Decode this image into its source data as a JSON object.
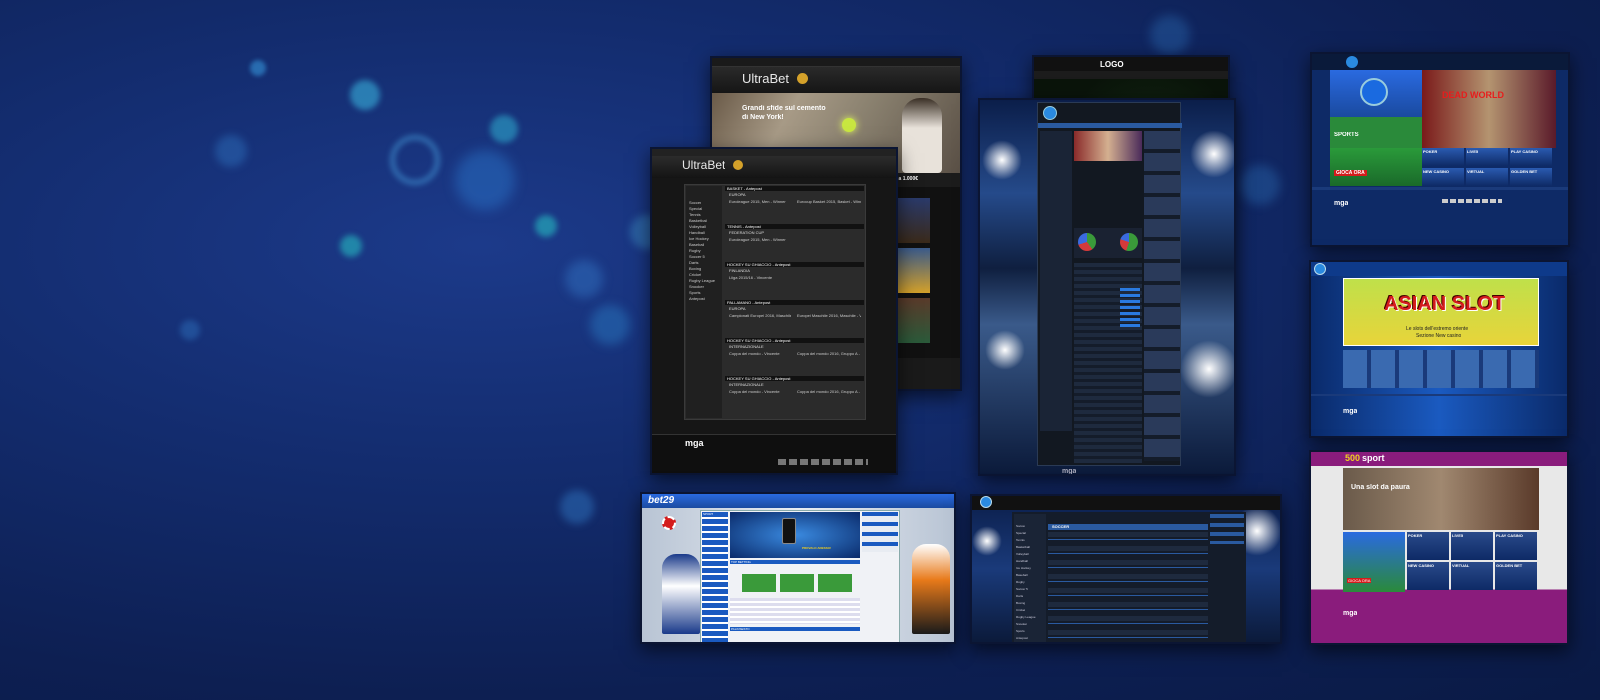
{
  "colors": {
    "background": "#0d1f52",
    "ultrabet_gold": "#d4a12a",
    "blue_accent": "#1e7ee0",
    "purple_accent": "#8a1c7c"
  },
  "ultrabet_back": {
    "brand": "UltraBet",
    "headline_line1": "Grandi sfide sul cemento",
    "headline_line2": "di New York!",
    "bonus": "fino a 1.000€"
  },
  "ultrabet_front": {
    "brand": "UltraBet",
    "sports": [
      "Soccer",
      "Special",
      "Tennis",
      "Basketball",
      "Volleyball",
      "Handball",
      "Ice Hockey",
      "Baseball",
      "Rugby",
      "Soccer 5",
      "Darts",
      "Boxing",
      "Cricket",
      "Rugby League",
      "Snooker",
      "Sports",
      "Antepost"
    ],
    "events": [
      {
        "title": "BASKET - Antepost",
        "group": "EUROPA",
        "left": "Euroleague 2015, Men - Winner",
        "right": "Eurocup Basket 2015, Basket - Winner"
      },
      {
        "title": "TENNIS - Antepost",
        "group": "FEDERATION CUP",
        "left": "Euroleague 2015, Men - Winner",
        "right": ""
      },
      {
        "title": "HOCKEY SU GHIACCIO - Antepost",
        "group": "FINLANDIA",
        "left": "Liiga 2015/16 - Vincente",
        "right": ""
      },
      {
        "title": "PALLAMANO - Antepost",
        "group": "EUROPA",
        "left": "Campionati Europei 2016, Maschile - Vincente",
        "right": "Europei Maschile 2016, Maschile - Vincente"
      },
      {
        "title": "HOCKEY SU GHIACCIO - Antepost",
        "group": "INTERNAZIONALE",
        "left": "Coppa del mondo - Vincente",
        "right": "Coppa del mondo 2016, Gruppo A - Vincente"
      },
      {
        "title": "HOCKEY SU GHIACCIO - Antepost",
        "group": "INTERNAZIONALE",
        "left": "Coppa del mondo - Vincente",
        "right": "Coppa del mondo 2016, Gruppo A - Vincente"
      }
    ],
    "footer_logo": "mga"
  },
  "dark_green_site": {
    "logo": "LOGO"
  },
  "stadium_site": {
    "footer_logo": "mga"
  },
  "blue_site_top": {
    "sports_label": "SPORTS",
    "cta": "GIOCA ORA",
    "dead_world": "DEAD WORLD",
    "tiles": [
      "POKER",
      "LIVE5",
      "PLAY CASINO",
      "NEW CASINO",
      "VIRTUAL",
      "GOLDEN BET"
    ],
    "footer_logo": "mga"
  },
  "asian_slot_site": {
    "title": "ASIAN SLOT",
    "subtitle_line1": "Le slots dell'estremo oriente",
    "subtitle_line2": "Sezione New casino",
    "footer_logo": "mga"
  },
  "sport500_site": {
    "brand_number": "500",
    "brand_word": "sport",
    "headline": "Una slot da paura",
    "cta": "GIOCA ORA",
    "tiles": [
      "SPORTS",
      "POKER",
      "LIVE5",
      "PLAY CASINO",
      "NEW CASINO",
      "VIRTUAL",
      "GOLDEN BET"
    ],
    "footer_logo": "mga"
  },
  "bet29_site": {
    "brand": "bet29",
    "promo": "PROVALO ADESSO!",
    "section_top": "TOP BETTING",
    "section_sport": "SPORT",
    "section_bottom": "PALINSESTO"
  },
  "soccer_site": {
    "section": "SOCCER",
    "sports": [
      "Soccer",
      "Special",
      "Tennis",
      "Basketball",
      "Volleyball",
      "Handball",
      "Ice Hockey",
      "Baseball",
      "Rugby",
      "Soccer 5",
      "Darts",
      "Boxing",
      "Cricket",
      "Rugby League",
      "Snooker",
      "Sports",
      "Antepost"
    ]
  }
}
